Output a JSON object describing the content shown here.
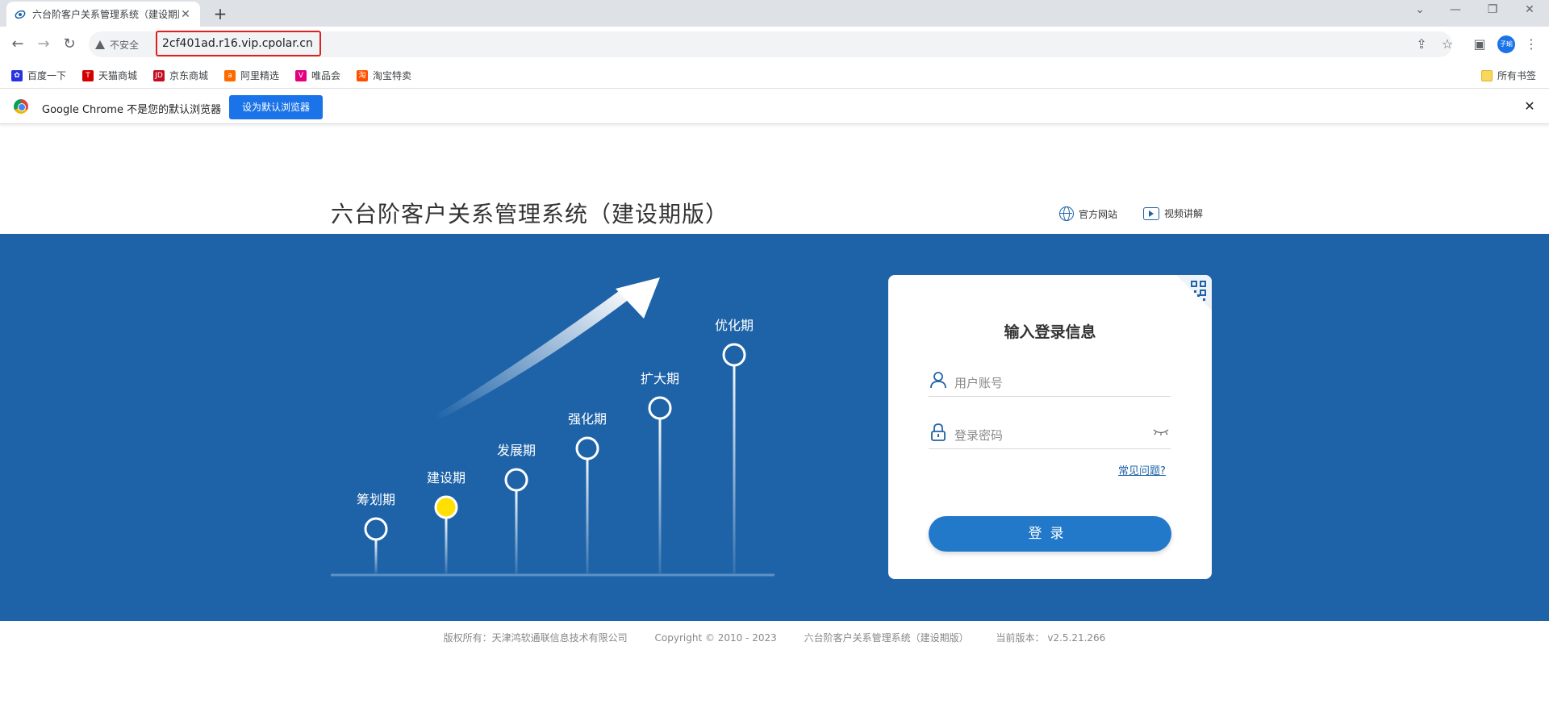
{
  "browser": {
    "tab_title": "六台阶客户关系管理系统（建设期版）",
    "tab_close": "✕",
    "new_tab": "+",
    "security_label": "不安全",
    "url": "2cf401ad.r16.vip.cpolar.cn",
    "profile_label": "子瑜",
    "bookmarks": [
      "百度一下",
      "天猫商城",
      "京东商城",
      "阿里精选",
      "唯品会",
      "淘宝特卖"
    ],
    "all_bookmarks": "所有书签",
    "infobar_text": "Google Chrome 不是您的默认浏览器",
    "infobar_button": "设为默认浏览器",
    "infobar_close": "✕"
  },
  "header": {
    "title": "六台阶客户关系管理系统（建设期版）",
    "links": [
      "官方网站",
      "视频讲解"
    ]
  },
  "stages": [
    {
      "label": "筹划期",
      "active": false
    },
    {
      "label": "建设期",
      "active": true
    },
    {
      "label": "发展期",
      "active": false
    },
    {
      "label": "强化期",
      "active": false
    },
    {
      "label": "扩大期",
      "active": false
    },
    {
      "label": "优化期",
      "active": false
    }
  ],
  "colors": {
    "banner": "#1e63a8",
    "button": "#2278c9",
    "active_stage": "#ffe000"
  },
  "login": {
    "title": "输入登录信息",
    "username_placeholder": "用户账号",
    "password_placeholder": "登录密码",
    "faq": "常见问题?",
    "submit": "登录",
    "icons": [
      "qr-code-icon",
      "user-icon",
      "lock-icon",
      "eye-closed-icon"
    ]
  },
  "footer": {
    "company": "版权所有：天津鸿软通联信息技术有限公司",
    "copyright": "Copyright © 2010 - 2023",
    "system": "六台阶客户关系管理系统（建设期版）",
    "version": "当前版本：  v2.5.21.266"
  }
}
